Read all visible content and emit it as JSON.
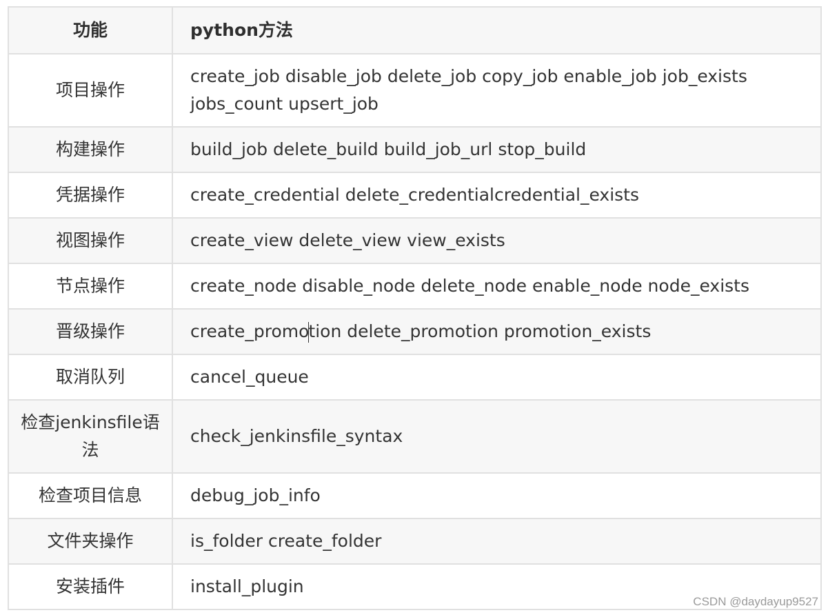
{
  "table": {
    "headers": [
      "功能",
      "python方法"
    ],
    "rows": [
      {
        "func": "项目操作",
        "methods": "create_job disable_job delete_job copy_job enable_job job_exists jobs_count upsert_job"
      },
      {
        "func": "构建操作",
        "methods": "build_job delete_build build_job_url stop_build"
      },
      {
        "func": "凭据操作",
        "methods": "create_credential delete_credentialcredential_exists"
      },
      {
        "func": "视图操作",
        "methods": "create_view delete_view view_exists"
      },
      {
        "func": "节点操作",
        "methods": "create_node disable_node delete_node enable_node node_exists"
      },
      {
        "func": "晋级操作",
        "methods_before_cursor": "create_promo",
        "methods_after_cursor": "tion delete_promotion promotion_exists"
      },
      {
        "func": "取消队列",
        "methods": "cancel_queue"
      },
      {
        "func": "检查jenkinsfile语法",
        "methods": "check_jenkinsfile_syntax"
      },
      {
        "func": "检查项目信息",
        "methods": "debug_job_info"
      },
      {
        "func": "文件夹操作",
        "methods": "is_folder create_folder"
      },
      {
        "func": "安装插件",
        "methods": "install_plugin"
      }
    ]
  },
  "watermark": "CSDN @daydayup9527"
}
